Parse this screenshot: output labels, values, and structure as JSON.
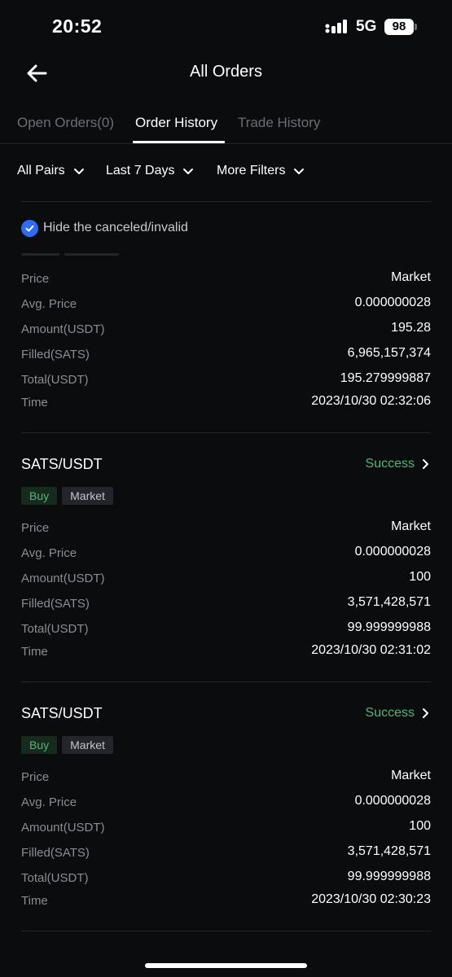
{
  "status_bar": {
    "time": "20:52",
    "network": "5G",
    "battery": "98"
  },
  "header": {
    "title": "All Orders",
    "back_icon": "arrow-left-icon"
  },
  "tabs": [
    {
      "label": "Open Orders(0)",
      "active": false
    },
    {
      "label": "Order History",
      "active": true
    },
    {
      "label": "Trade History",
      "active": false
    }
  ],
  "filters": [
    {
      "label": "All Pairs"
    },
    {
      "label": "Last 7 Days"
    },
    {
      "label": "More Filters"
    }
  ],
  "hide_canceled": {
    "label": "Hide the canceled/invalid",
    "checked": true
  },
  "colors": {
    "accent_blue": "#2f6cf1",
    "success_green": "#4fb878",
    "background": "#0b0c0e"
  },
  "orders": [
    {
      "rows": [
        {
          "label": "Price",
          "value": "Market"
        },
        {
          "label": "Avg. Price",
          "value": "0.000000028"
        },
        {
          "label": "Amount(USDT)",
          "value": "195.28"
        },
        {
          "label": "Filled(SATS)",
          "value": "6,965,157,374"
        },
        {
          "label": "Total(USDT)",
          "value": "195.279999887"
        },
        {
          "label": "Time",
          "value": "2023/10/30 02:32:06"
        }
      ]
    },
    {
      "pair": "SATS/USDT",
      "status": "Success",
      "side": "Buy",
      "type": "Market",
      "rows": [
        {
          "label": "Price",
          "value": "Market"
        },
        {
          "label": "Avg. Price",
          "value": "0.000000028"
        },
        {
          "label": "Amount(USDT)",
          "value": "100"
        },
        {
          "label": "Filled(SATS)",
          "value": "3,571,428,571"
        },
        {
          "label": "Total(USDT)",
          "value": "99.999999988"
        },
        {
          "label": "Time",
          "value": "2023/10/30 02:31:02"
        }
      ]
    },
    {
      "pair": "SATS/USDT",
      "status": "Success",
      "side": "Buy",
      "type": "Market",
      "rows": [
        {
          "label": "Price",
          "value": "Market"
        },
        {
          "label": "Avg. Price",
          "value": "0.000000028"
        },
        {
          "label": "Amount(USDT)",
          "value": "100"
        },
        {
          "label": "Filled(SATS)",
          "value": "3,571,428,571"
        },
        {
          "label": "Total(USDT)",
          "value": "99.999999988"
        },
        {
          "label": "Time",
          "value": "2023/10/30 02:30:23"
        }
      ]
    }
  ]
}
